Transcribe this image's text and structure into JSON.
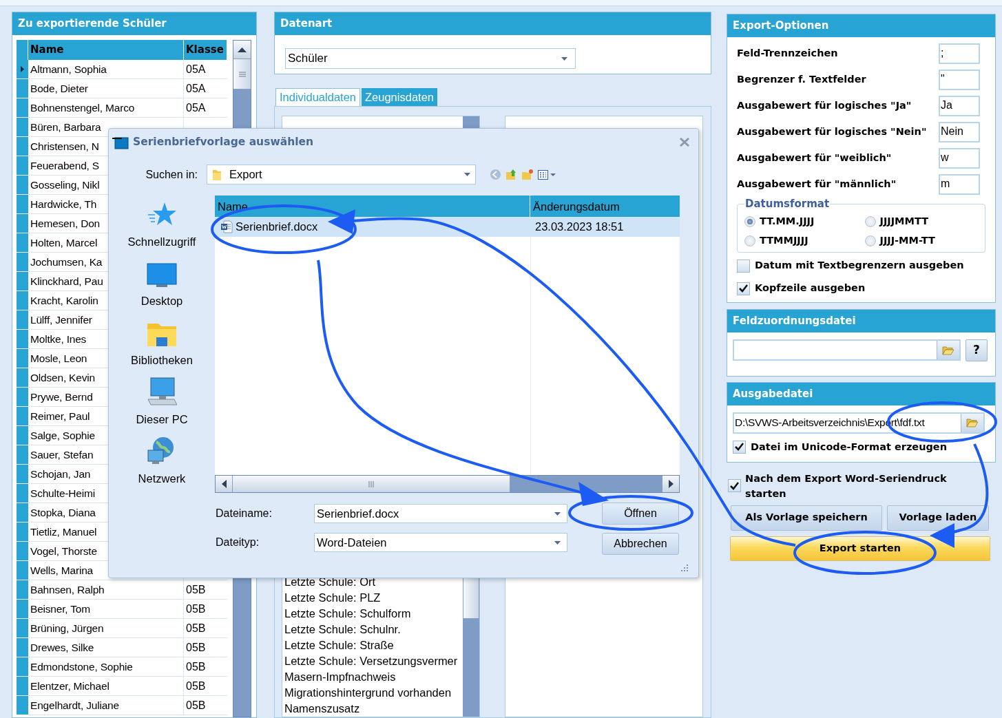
{
  "students": {
    "title": "Zu exportierende Schüler",
    "columns": [
      "Name",
      "Klasse"
    ],
    "rows": [
      {
        "name": "Altmann, Sophia",
        "klasse": "05A",
        "current": true
      },
      {
        "name": "Bode, Dieter",
        "klasse": "05A",
        "current": false
      },
      {
        "name": "Bohnenstengel, Marco",
        "klasse": "05A",
        "current": false
      },
      {
        "name": "Büren, Barbara",
        "current": false
      },
      {
        "name": "Christensen, N",
        "current": false
      },
      {
        "name": "Feuerabend, S",
        "current": false
      },
      {
        "name": "Gosseling, Nikl",
        "current": false
      },
      {
        "name": "Hardwicke, Th",
        "current": false
      },
      {
        "name": "Hemesen, Don",
        "current": false
      },
      {
        "name": "Holten, Marcel",
        "current": false
      },
      {
        "name": "Jochumsen, Ka",
        "current": false
      },
      {
        "name": "Klinckhard, Pau",
        "current": false
      },
      {
        "name": "Kracht, Karolin",
        "current": false
      },
      {
        "name": "Lülff, Jennifer",
        "current": false
      },
      {
        "name": "Moltke, Ines",
        "current": false
      },
      {
        "name": "Mosle, Leon",
        "current": false
      },
      {
        "name": "Oldsen, Kevin",
        "current": false
      },
      {
        "name": "Prywe, Bernd",
        "current": false
      },
      {
        "name": "Reimer, Paul",
        "current": false
      },
      {
        "name": "Salge, Sophie",
        "current": false
      },
      {
        "name": "Sauer, Stefan",
        "current": false
      },
      {
        "name": "Schojan, Jan",
        "current": false
      },
      {
        "name": "Schulte-Heimi",
        "current": false
      },
      {
        "name": "Stopka, Diana",
        "current": false
      },
      {
        "name": "Tietliz, Manuel",
        "current": false
      },
      {
        "name": "Vogel, Thorste",
        "current": false
      },
      {
        "name": "Wells, Marina",
        "current": false
      },
      {
        "name": "Bahnsen, Ralph",
        "klasse": "05B",
        "current": false
      },
      {
        "name": "Beisner, Tom",
        "klasse": "05B",
        "current": false
      },
      {
        "name": "Brüning, Jürgen",
        "klasse": "05B",
        "current": false
      },
      {
        "name": "Drewes, Silke",
        "klasse": "05B",
        "current": false
      },
      {
        "name": "Edmondstone, Sophie",
        "klasse": "05B",
        "current": false
      },
      {
        "name": "Elentzer, Michael",
        "klasse": "05B",
        "current": false
      },
      {
        "name": "Engelhardt, Juliane",
        "klasse": "05B",
        "current": false
      }
    ]
  },
  "datenart": {
    "title": "Datenart",
    "value": "Schüler"
  },
  "tabs": [
    {
      "label": "Individualdaten",
      "selected": true
    },
    {
      "label": "Zeugnisdaten",
      "selected": false
    }
  ],
  "fields_list": [
    "Letzte Schule: Ort",
    "Letzte Schule: PLZ",
    "Letzte Schule: Schulform",
    "Letzte Schule: Schulnr.",
    "Letzte Schule: Straße",
    "Letzte Schule: Versetzungsvermer",
    "Masern-Impfnachweis",
    "Migrationshintergrund vorhanden",
    "Namenszusatz"
  ],
  "export_options": {
    "title": "Export-Optionen",
    "fields": [
      {
        "label": "Feld-Trennzeichen",
        "value": ";"
      },
      {
        "label": "Begrenzer f. Textfelder",
        "value": "\""
      },
      {
        "label": "Ausgabewert für logisches \"Ja\"",
        "value": "Ja"
      },
      {
        "label": "Ausgabewert für logisches \"Nein\"",
        "value": "Nein"
      },
      {
        "label": "Ausgabewert für \"weiblich\"",
        "value": "w"
      },
      {
        "label": "Ausgabewert für \"männlich\"",
        "value": "m"
      }
    ],
    "date_format": {
      "title": "Datumsformat",
      "options": [
        {
          "label": "TT.MM.JJJJ",
          "selected": true
        },
        {
          "label": "JJJJMMTT",
          "selected": false
        },
        {
          "label": "TTMMJJJJ",
          "selected": false
        },
        {
          "label": "JJJJ-MM-TT",
          "selected": false
        }
      ]
    },
    "checkboxes": [
      {
        "label": "Datum mit Textbegrenzern ausgeben",
        "checked": false
      },
      {
        "label": "Kopfzeile ausgeben",
        "checked": true
      }
    ]
  },
  "field_mapping": {
    "title": "Feldzuordnungsdatei",
    "help": "?"
  },
  "output_file": {
    "title": "Ausgabedatei",
    "path": "D:\\SVWS-Arbeitsverzeichnis\\Export\\fdf.txt",
    "unicode": {
      "label": "Datei im Unicode-Format erzeugen",
      "checked": true
    }
  },
  "word_merge": {
    "label": "Nach dem Export Word-Seriendruck starten",
    "checked": true
  },
  "buttons": [
    {
      "label": "Als Vorlage speichern",
      "kind": "normal"
    },
    {
      "label": "Vorlage laden",
      "kind": "normal"
    },
    {
      "label": "Export starten",
      "kind": "primary"
    }
  ],
  "dialog": {
    "title": "Serienbriefvorlage auswählen",
    "look_in_label": "Suchen in:",
    "look_in_value": "Export",
    "places": [
      {
        "label": "Schnellzugriff",
        "kind": "star"
      },
      {
        "label": "Desktop",
        "kind": "desktop"
      },
      {
        "label": "Bibliotheken",
        "kind": "libraries"
      },
      {
        "label": "Dieser PC",
        "kind": "pc"
      },
      {
        "label": "Netzwerk",
        "kind": "network"
      }
    ],
    "columns": [
      "Name",
      "Änderungsdatum"
    ],
    "files": [
      {
        "name": "Serienbrief.docx",
        "date": "23.03.2023 18:51",
        "selected": true
      }
    ],
    "filename_label": "Dateiname:",
    "filename_value": "Serienbrief.docx",
    "filetype_label": "Dateityp:",
    "filetype_value": "Word-Dateien",
    "buttons": [
      "Öffnen",
      "Abbrechen"
    ]
  }
}
